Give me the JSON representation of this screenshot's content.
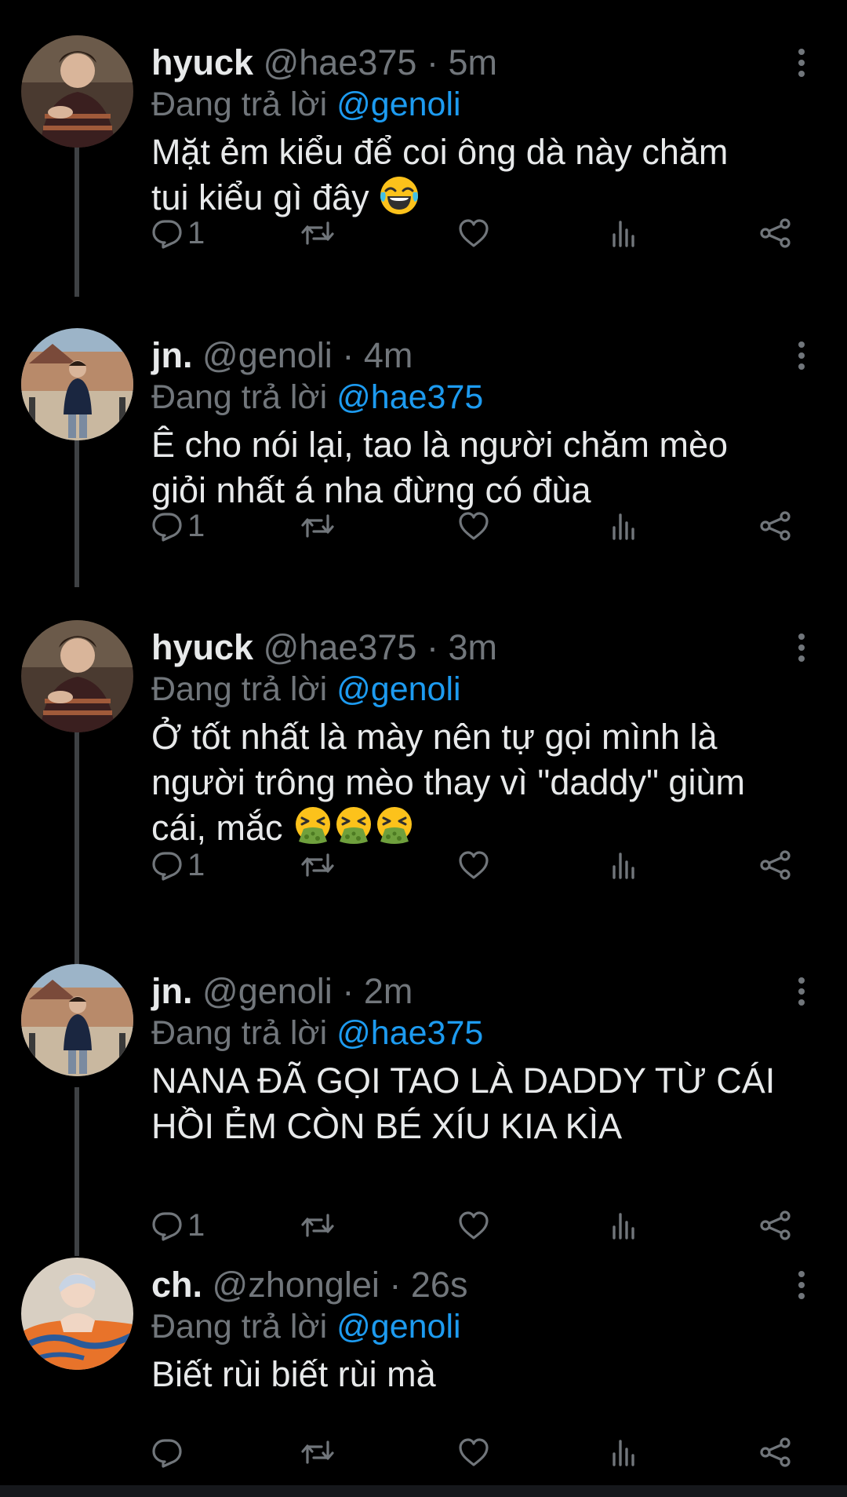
{
  "tweets": [
    {
      "name": "hyuck",
      "handle": "@hae375",
      "separator": "·",
      "time": "5m",
      "reply_prefix": "Đang trả lời",
      "reply_to": "@genoli",
      "line1": "Mặt ẻm kiểu để coi ông dà này chăm",
      "line2": "tui kiểu gì đây",
      "emoji": "face-with-tears-of-joy",
      "reply_count": "1",
      "avatar": "hyuck-avatar"
    },
    {
      "name": "jn.",
      "handle": "@genoli",
      "separator": "·",
      "time": "4m",
      "reply_prefix": "Đang trả lời",
      "reply_to": "@hae375",
      "line1": "Ê cho nói lại, tao là người chăm mèo",
      "line2": "giỏi nhất á nha đừng có đùa",
      "reply_count": "1",
      "avatar": "jn-avatar"
    },
    {
      "name": "hyuck",
      "handle": "@hae375",
      "separator": "·",
      "time": "3m",
      "reply_prefix": "Đang trả lời",
      "reply_to": "@genoli",
      "line1": "Ở tốt nhất là mày nên tự gọi mình là",
      "line2": "người trông mèo thay vì \"daddy\" giùm",
      "line3": "cái, mắc",
      "emoji": "face-vomiting",
      "reply_count": "1",
      "avatar": "hyuck-avatar"
    },
    {
      "name": "jn.",
      "handle": "@genoli",
      "separator": "·",
      "time": "2m",
      "reply_prefix": "Đang trả lời",
      "reply_to": "@hae375",
      "line1": "NANA ĐÃ GỌI TAO LÀ DADDY TỪ CÁI",
      "line2": "HỒI ẺM CÒN BÉ XÍU KIA KÌA",
      "reply_count": "1",
      "avatar": "jn-avatar"
    },
    {
      "name": "ch.",
      "handle": "@zhonglei",
      "separator": "·",
      "time": "26s",
      "reply_prefix": "Đang trả lời",
      "reply_to": "@genoli",
      "line1": "Biết rùi biết rùi mà",
      "reply_count": "",
      "avatar": "ch-avatar"
    }
  ],
  "icons": {
    "reply": "reply-icon",
    "retweet": "retweet-icon",
    "like": "heart-icon",
    "views": "analytics-icon",
    "share": "share-icon",
    "more": "more-vertical-icon"
  },
  "colors": {
    "background": "#000000",
    "text": "#e7e9ea",
    "muted": "#71767b",
    "link": "#1d9bf0",
    "thread_line": "#3e4144"
  }
}
